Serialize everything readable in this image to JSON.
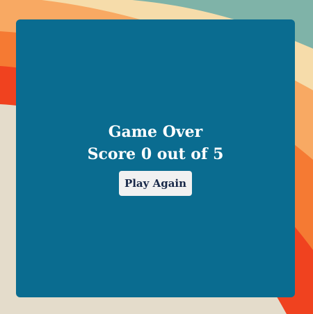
{
  "background": {
    "colors": {
      "base": "#e4dccb",
      "teal": "#7fb3a8",
      "cream": "#f6dcaa",
      "peach": "#f8a963",
      "orange": "#f57a33",
      "red": "#f0421f"
    }
  },
  "game_over": {
    "title": "Game Over",
    "score_text": "Score 0 out of 5",
    "score": 0,
    "total": 5,
    "play_again_label": "Play Again",
    "panel_color": "#0a6c90"
  }
}
